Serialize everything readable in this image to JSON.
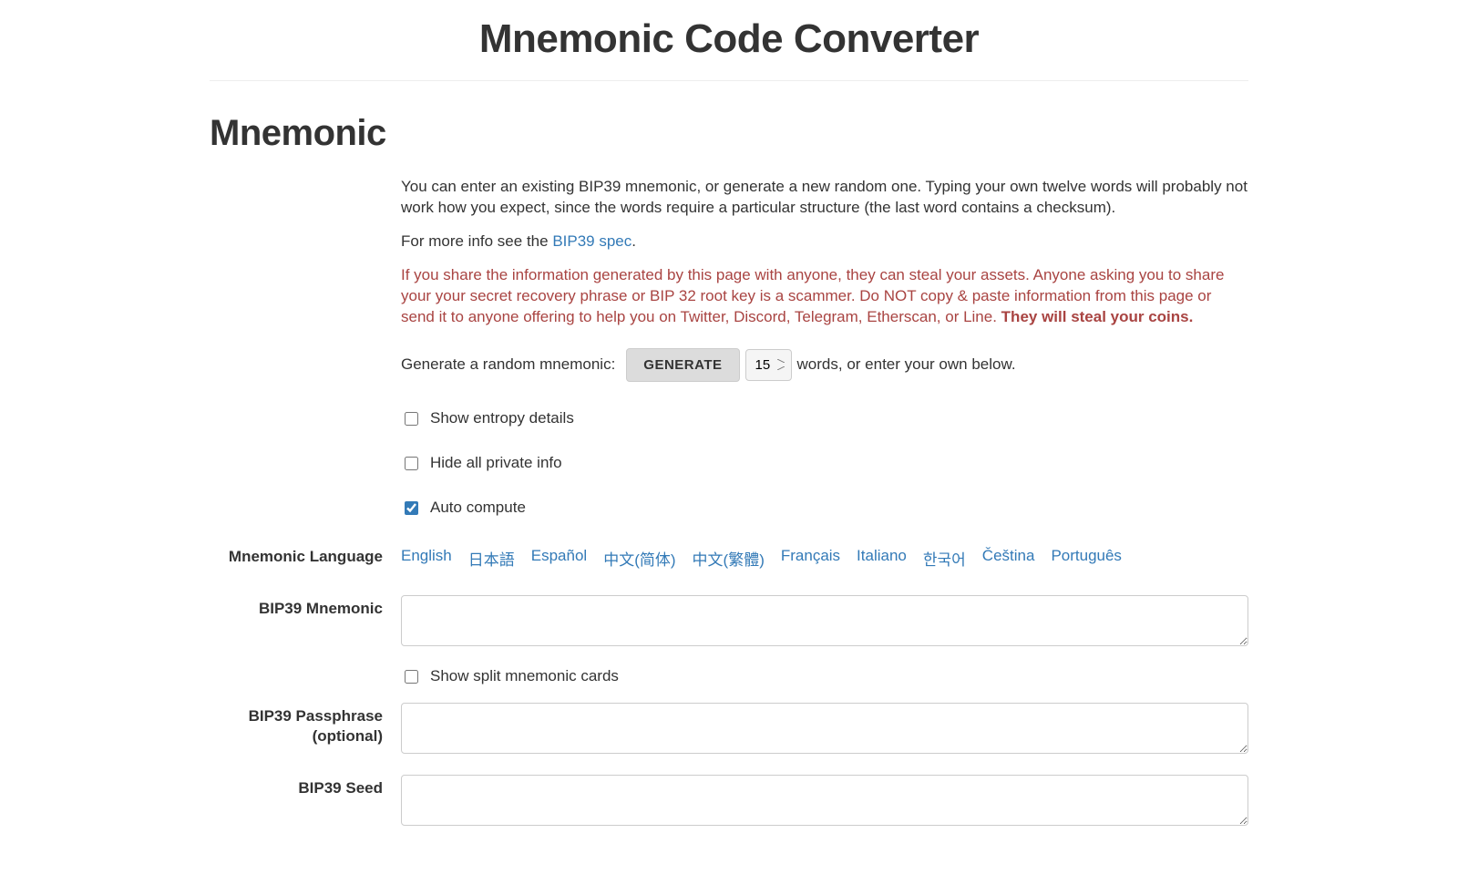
{
  "page": {
    "title": "Mnemonic Code Converter",
    "section_heading": "Mnemonic"
  },
  "intro": {
    "para1": "You can enter an existing BIP39 mnemonic, or generate a new random one. Typing your own twelve words will probably not work how you expect, since the words require a particular structure (the last word contains a checksum).",
    "para2_prefix": "For more info see the ",
    "para2_link": "BIP39 spec",
    "para2_suffix": ".",
    "warning_text": "If you share the information generated by this page with anyone, they can steal your assets. Anyone asking you to share your your secret recovery phrase or BIP 32 root key is a scammer. Do NOT copy & paste information from this page or send it to anyone offering to help you on Twitter, Discord, Telegram, Etherscan, or Line. ",
    "warning_bold": "They will steal your coins."
  },
  "generate": {
    "lead": "Generate a random mnemonic:",
    "button": "GENERATE",
    "selected_words": "15",
    "trail": "words, or enter your own below."
  },
  "checkboxes": {
    "show_entropy": "Show entropy details",
    "hide_private": "Hide all private info",
    "auto_compute": "Auto compute",
    "show_split": "Show split mnemonic cards"
  },
  "labels": {
    "mnemonic_language": "Mnemonic Language",
    "bip39_mnemonic": "BIP39 Mnemonic",
    "bip39_passphrase_line1": "BIP39 Passphrase",
    "bip39_passphrase_line2": "(optional)",
    "bip39_seed": "BIP39 Seed"
  },
  "languages": [
    "English",
    "日本語",
    "Español",
    "中文(简体)",
    "中文(繁體)",
    "Français",
    "Italiano",
    "한국어",
    "Čeština",
    "Português"
  ],
  "values": {
    "mnemonic": "",
    "passphrase": "",
    "seed": ""
  }
}
